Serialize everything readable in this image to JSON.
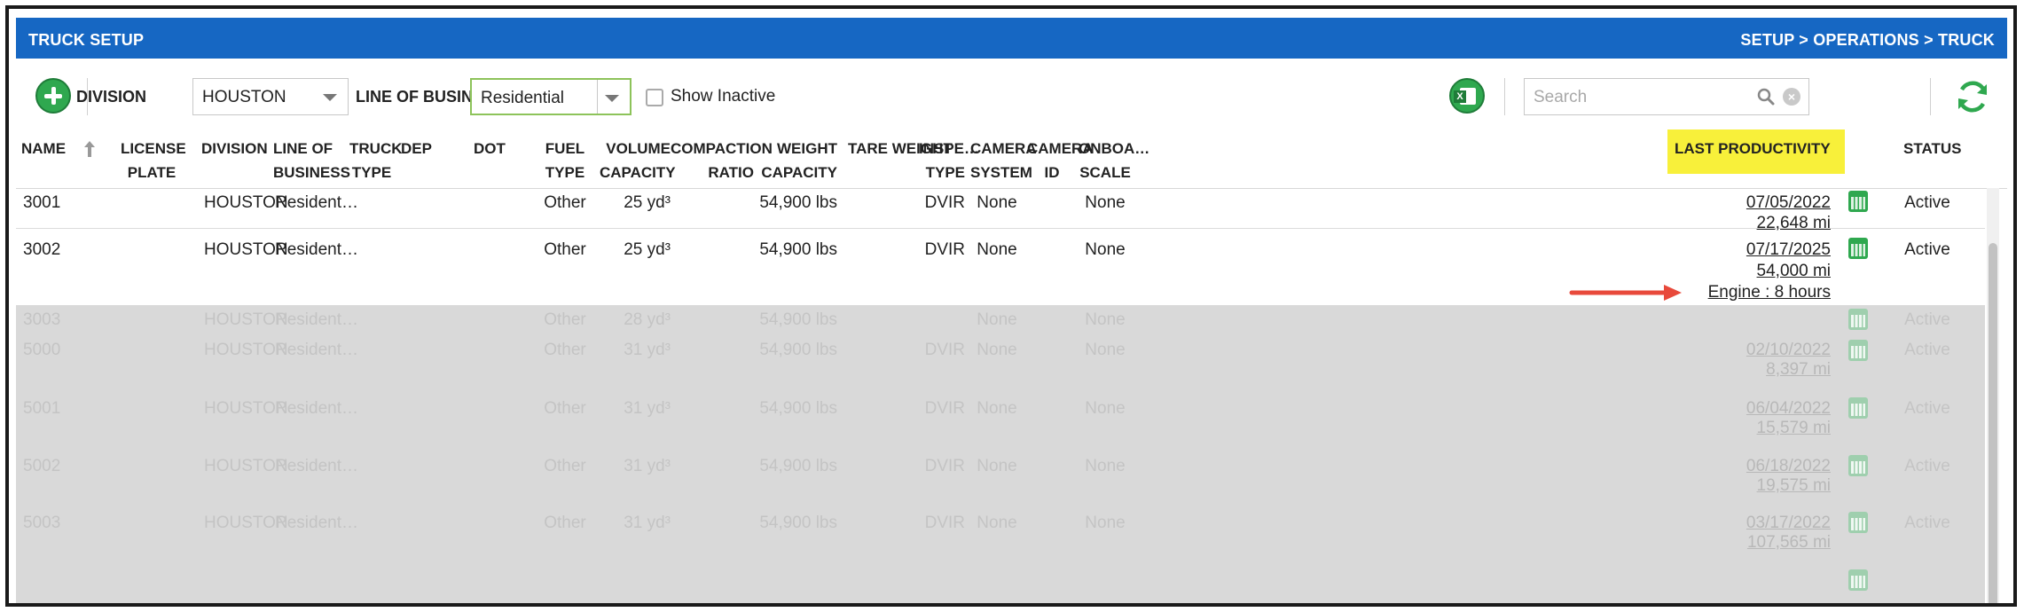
{
  "header": {
    "title": "TRUCK SETUP",
    "breadcrumb": "SETUP > OPERATIONS > TRUCK"
  },
  "toolbar": {
    "division_label": "DIVISION",
    "division_value": "HOUSTON",
    "lob_label": "LINE OF BUSINESS",
    "lob_value": "Residential",
    "show_inactive_label": "Show Inactive",
    "search_placeholder": "Search",
    "excel_glyph": "X"
  },
  "columns": {
    "name": "NAME",
    "license_1": "LICENSE",
    "license_2": "PLATE",
    "division": "DIVISION",
    "lob_1": "LINE OF",
    "lob_2": "BUSINESS",
    "truck_1": "TRUCK",
    "truck_2": "TYPE",
    "dep": "DEP",
    "dot": "DOT",
    "fuel_1": "FUEL",
    "fuel_2": "TYPE",
    "volume_1": "VOLUME",
    "volume_2": "CAPACITY",
    "compaction_1": "COMPACTION",
    "compaction_2": "RATIO",
    "weight_1": "WEIGHT",
    "weight_2": "CAPACITY",
    "tare": "TARE WEIGHT",
    "insp_1": "INSPE…",
    "insp_2": "TYPE",
    "camsys_1": "CAMERA",
    "camsys_2": "SYSTEM",
    "camid_1": "CAMERA",
    "camid_2": "ID",
    "onboard_1": "ONBOA…",
    "onboard_2": "SCALE",
    "last_productivity": "LAST PRODUCTIVITY",
    "status": "STATUS"
  },
  "rows": [
    {
      "name": "3001",
      "division": "HOUSTON",
      "lob": "Resident…",
      "fuel": "Other",
      "volume": "25 yd³",
      "weight": "54,900 lbs",
      "insp": "DVIR",
      "camsys": "None",
      "onboard": "None",
      "prod_date": "07/05/2022",
      "prod_mi": "22,648 mi",
      "status": "Active"
    },
    {
      "name": "3002",
      "division": "HOUSTON",
      "lob": "Resident…",
      "fuel": "Other",
      "volume": "25 yd³",
      "weight": "54,900 lbs",
      "insp": "DVIR",
      "camsys": "None",
      "onboard": "None",
      "prod_date": "07/17/2025",
      "prod_mi": "54,000 mi",
      "prod_engine": "Engine : 8 hours",
      "status": "Active"
    },
    {
      "name": "3003",
      "division": "HOUSTON",
      "lob": "Resident…",
      "fuel": "Other",
      "volume": "28 yd³",
      "weight": "54,900 lbs",
      "insp": "",
      "camsys": "None",
      "onboard": "None",
      "prod_date": "",
      "prod_mi": "",
      "status": "Active"
    },
    {
      "name": "5000",
      "division": "HOUSTON",
      "lob": "Resident…",
      "fuel": "Other",
      "volume": "31 yd³",
      "weight": "54,900 lbs",
      "insp": "DVIR",
      "camsys": "None",
      "onboard": "None",
      "prod_date": "02/10/2022",
      "prod_mi": "8,397 mi",
      "status": "Active"
    },
    {
      "name": "5001",
      "division": "HOUSTON",
      "lob": "Resident…",
      "fuel": "Other",
      "volume": "31 yd³",
      "weight": "54,900 lbs",
      "insp": "DVIR",
      "camsys": "None",
      "onboard": "None",
      "prod_date": "06/04/2022",
      "prod_mi": "15,579 mi",
      "status": "Active"
    },
    {
      "name": "5002",
      "division": "HOUSTON",
      "lob": "Resident…",
      "fuel": "Other",
      "volume": "31 yd³",
      "weight": "54,900 lbs",
      "insp": "DVIR",
      "camsys": "None",
      "onboard": "None",
      "prod_date": "06/18/2022",
      "prod_mi": "19,575 mi",
      "status": "Active"
    },
    {
      "name": "5003",
      "division": "HOUSTON",
      "lob": "Resident…",
      "fuel": "Other",
      "volume": "31 yd³",
      "weight": "54,900 lbs",
      "insp": "DVIR",
      "camsys": "None",
      "onboard": "None",
      "prod_date": "03/17/2022",
      "prod_mi": "107,565 mi",
      "status": "Active"
    }
  ],
  "colors": {
    "header_blue": "#1667c3",
    "accent_green": "#2fa84f",
    "highlight_yellow": "#f8f03a",
    "arrow_red": "#e8493b"
  }
}
